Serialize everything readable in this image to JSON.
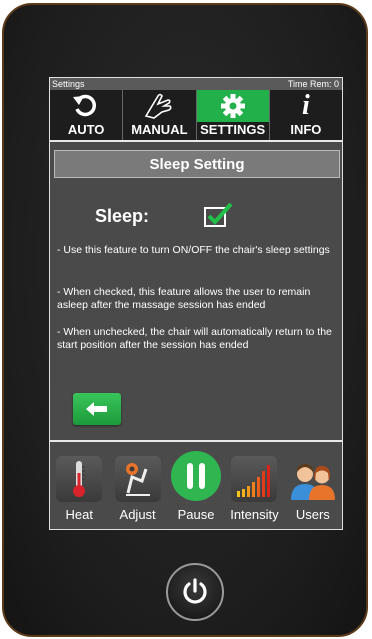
{
  "status_bar": {
    "screen_name": "Settings",
    "time_remaining": "Time Rem: 0"
  },
  "tabs": [
    {
      "label": "AUTO",
      "icon": "refresh-icon"
    },
    {
      "label": "MANUAL",
      "icon": "hand-icon"
    },
    {
      "label": "SETTINGS",
      "icon": "gear-icon"
    },
    {
      "label": "INFO",
      "icon": "info-icon"
    }
  ],
  "active_tab": "SETTINGS",
  "section_title": "Sleep Setting",
  "sleep": {
    "label": "Sleep:",
    "checked": true
  },
  "descriptions": [
    "- Use this feature to turn ON/OFF the chair's sleep settings",
    "- When checked, this feature allows the user to remain asleep after the massage session has ended",
    "- When unchecked, the chair will automatically return to the start position after the session has ended"
  ],
  "toolbar": [
    {
      "label": "Heat",
      "icon": "thermometer-icon"
    },
    {
      "label": "Adjust",
      "icon": "chair-adjust-icon"
    },
    {
      "label": "Pause",
      "icon": "pause-icon"
    },
    {
      "label": "Intensity",
      "icon": "intensity-bars-icon"
    },
    {
      "label": "Users",
      "icon": "users-icon"
    }
  ],
  "colors": {
    "accent_green": "#22b04a",
    "screen_bg": "#4a4a4a"
  }
}
